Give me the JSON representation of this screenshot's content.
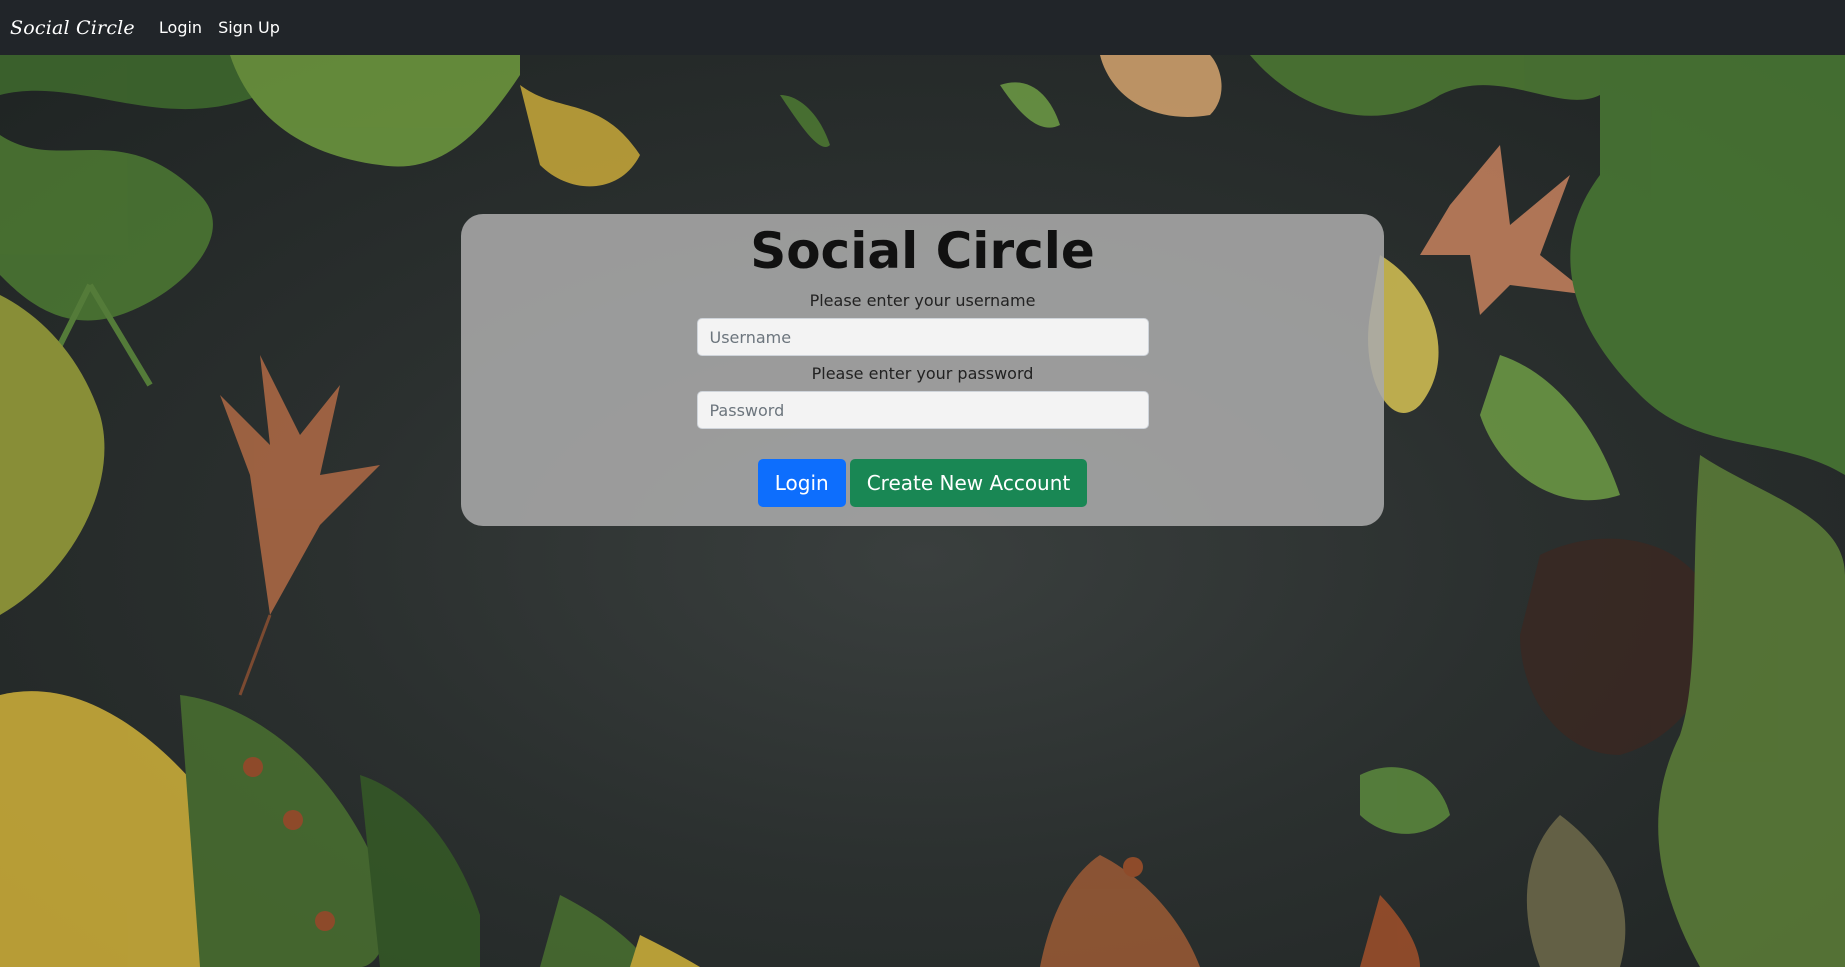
{
  "nav": {
    "brand": "Social Circle",
    "links": [
      "Login",
      "Sign Up"
    ]
  },
  "card": {
    "title": "Social Circle",
    "username_prompt": "Please enter your username",
    "username_placeholder": "Username",
    "password_prompt": "Please enter your password",
    "password_placeholder": "Password",
    "login_button": "Login",
    "create_button": "Create New Account"
  },
  "colors": {
    "navbar": "#212529",
    "login_button": "#0d6efd",
    "create_button": "#198754",
    "card_background": "#aaaaaa"
  }
}
